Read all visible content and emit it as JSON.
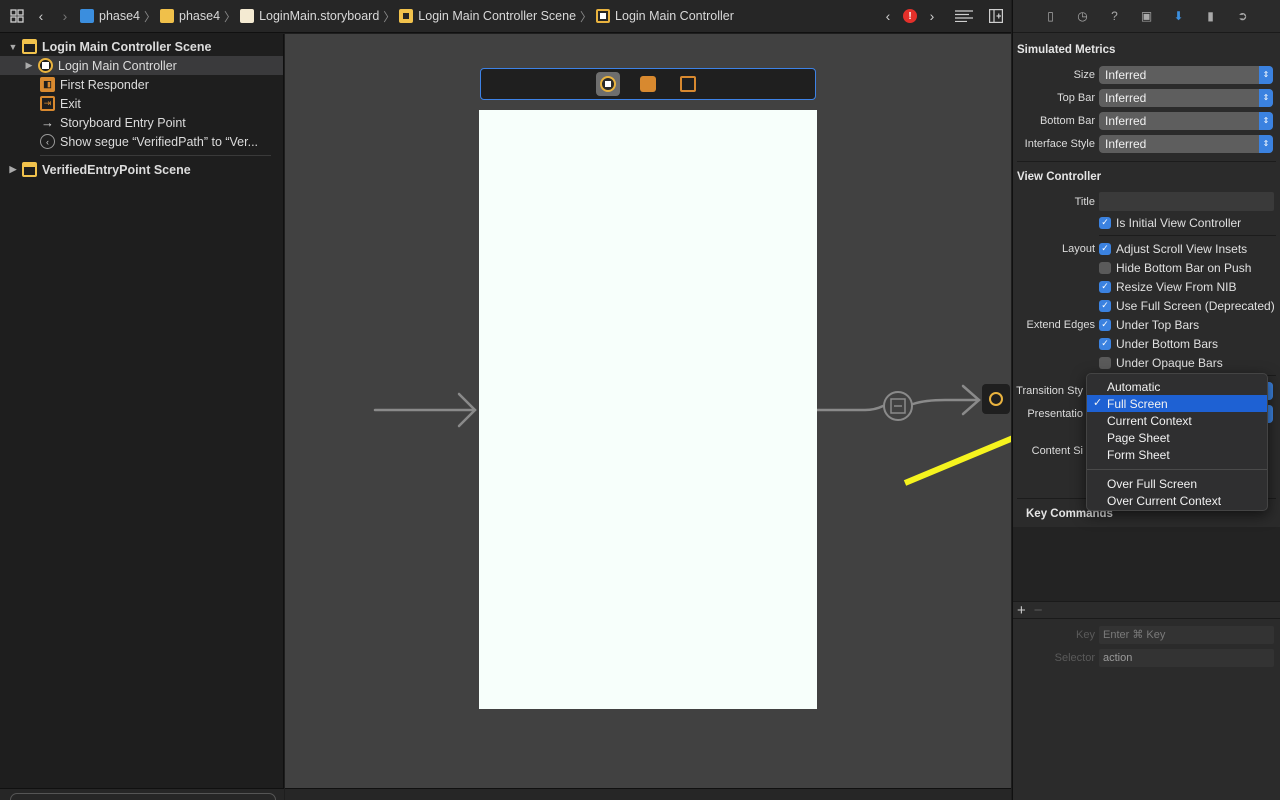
{
  "jumpbar": {
    "crumbs": [
      "phase4",
      "phase4",
      "LoginMain.storyboard",
      "Login Main Controller Scene",
      "Login Main Controller"
    ]
  },
  "outline": {
    "scene1": "Login Main Controller Scene",
    "items": [
      "Login Main Controller",
      "First Responder",
      "Exit",
      "Storyboard Entry Point",
      "Show segue “VerifiedPath” to “Ver..."
    ],
    "scene2": "VerifiedEntryPoint Scene"
  },
  "inspector": {
    "simulated_metrics": {
      "title": "Simulated Metrics",
      "rows": [
        {
          "label": "Size",
          "value": "Inferred"
        },
        {
          "label": "Top Bar",
          "value": "Inferred"
        },
        {
          "label": "Bottom Bar",
          "value": "Inferred"
        },
        {
          "label": "Interface Style",
          "value": "Inferred"
        }
      ]
    },
    "view_controller": {
      "title": "View Controller",
      "title_label": "Title",
      "is_initial": "Is Initial View Controller",
      "layout_label": "Layout",
      "layout_opts": [
        {
          "text": "Adjust Scroll View Insets",
          "checked": true
        },
        {
          "text": "Hide Bottom Bar on Push",
          "checked": false
        },
        {
          "text": "Resize View From NIB",
          "checked": true
        },
        {
          "text": "Use Full Screen (Deprecated)",
          "checked": true
        }
      ],
      "extend_label": "Extend Edges",
      "extend_opts": [
        {
          "text": "Under Top Bars",
          "checked": true
        },
        {
          "text": "Under Bottom Bars",
          "checked": true
        },
        {
          "text": "Under Opaque Bars",
          "checked": false
        }
      ],
      "transition_label": "Transition Sty",
      "presentation_label": "Presentatio",
      "content_label": "Content Si"
    },
    "key_commands": {
      "title": "Key Commands",
      "key_label": "Key",
      "key_placeholder": "Enter ⌘ Key",
      "selector_label": "Selector",
      "selector_value": "action"
    }
  },
  "menu": {
    "group1": [
      "Automatic",
      "Full Screen",
      "Current Context",
      "Page Sheet",
      "Form Sheet"
    ],
    "group2": [
      "Over Full Screen",
      "Over Current Context"
    ],
    "selected": "Full Screen"
  },
  "colors": {
    "accent": "#3b82e0",
    "highlight": "#1e61d3",
    "annotation_arrow": "#f5f31e"
  }
}
